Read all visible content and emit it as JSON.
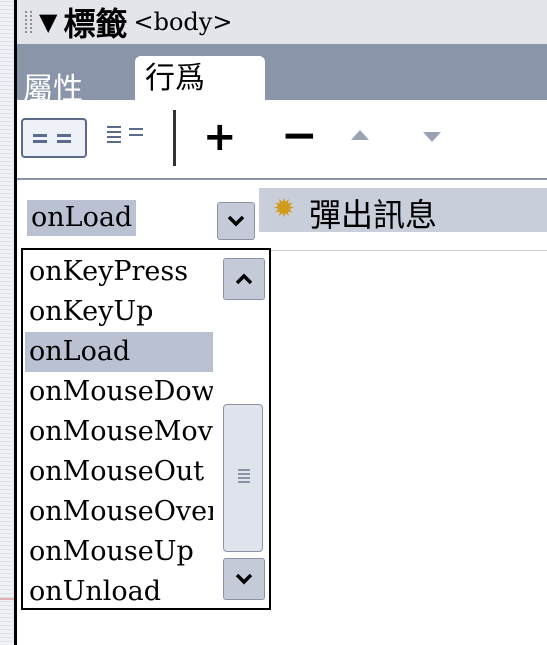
{
  "panel": {
    "title": "標籤",
    "tag": "<body>",
    "tabs": [
      {
        "label": "屬性",
        "active": false
      },
      {
        "label": "行爲",
        "active": true
      }
    ]
  },
  "toolbar": {
    "icons": [
      "show-set-events-icon",
      "show-all-events-icon",
      "add-behavior-icon",
      "remove-behavior-icon",
      "move-up-icon",
      "move-down-icon"
    ],
    "add_label": "+",
    "remove_label": "−"
  },
  "behavior_row": {
    "event": "onLoad",
    "action": "彈出訊息"
  },
  "event_dropdown": {
    "options": [
      "onKeyPress",
      "onKeyUp",
      "onLoad",
      "onMouseDown",
      "onMouseMove",
      "onMouseOut",
      "onMouseOver",
      "onMouseUp",
      "onUnload"
    ],
    "selected": "onLoad"
  },
  "colors": {
    "tab_bar": "#8a95aa",
    "selection": "#b9c1d2",
    "title_bar": "#e3e5ea"
  }
}
